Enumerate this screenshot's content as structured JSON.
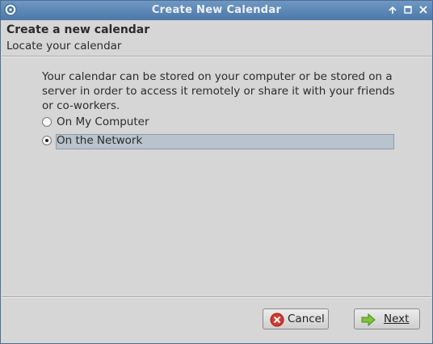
{
  "window": {
    "title": "Create New Calendar",
    "icons": [
      "app-icon",
      "roll-up-icon",
      "maximize-icon",
      "close-icon"
    ]
  },
  "header": {
    "title": "Create a new calendar",
    "subtitle": "Locate your calendar"
  },
  "main": {
    "description": "Your calendar can be stored on your computer or be stored on a server in order to access it remotely or share it with your friends or co-workers.",
    "options": [
      {
        "label": "On My Computer",
        "selected": false
      },
      {
        "label": "On the Network",
        "selected": true
      }
    ]
  },
  "footer": {
    "cancel_label": "Cancel",
    "next_label": "Next"
  },
  "colors": {
    "titlebar": "#5a84b3",
    "background": "#d6d6d6",
    "selection": "#b8c3cd",
    "cancel_icon": "#d8362c",
    "next_icon": "#7cc43a"
  }
}
